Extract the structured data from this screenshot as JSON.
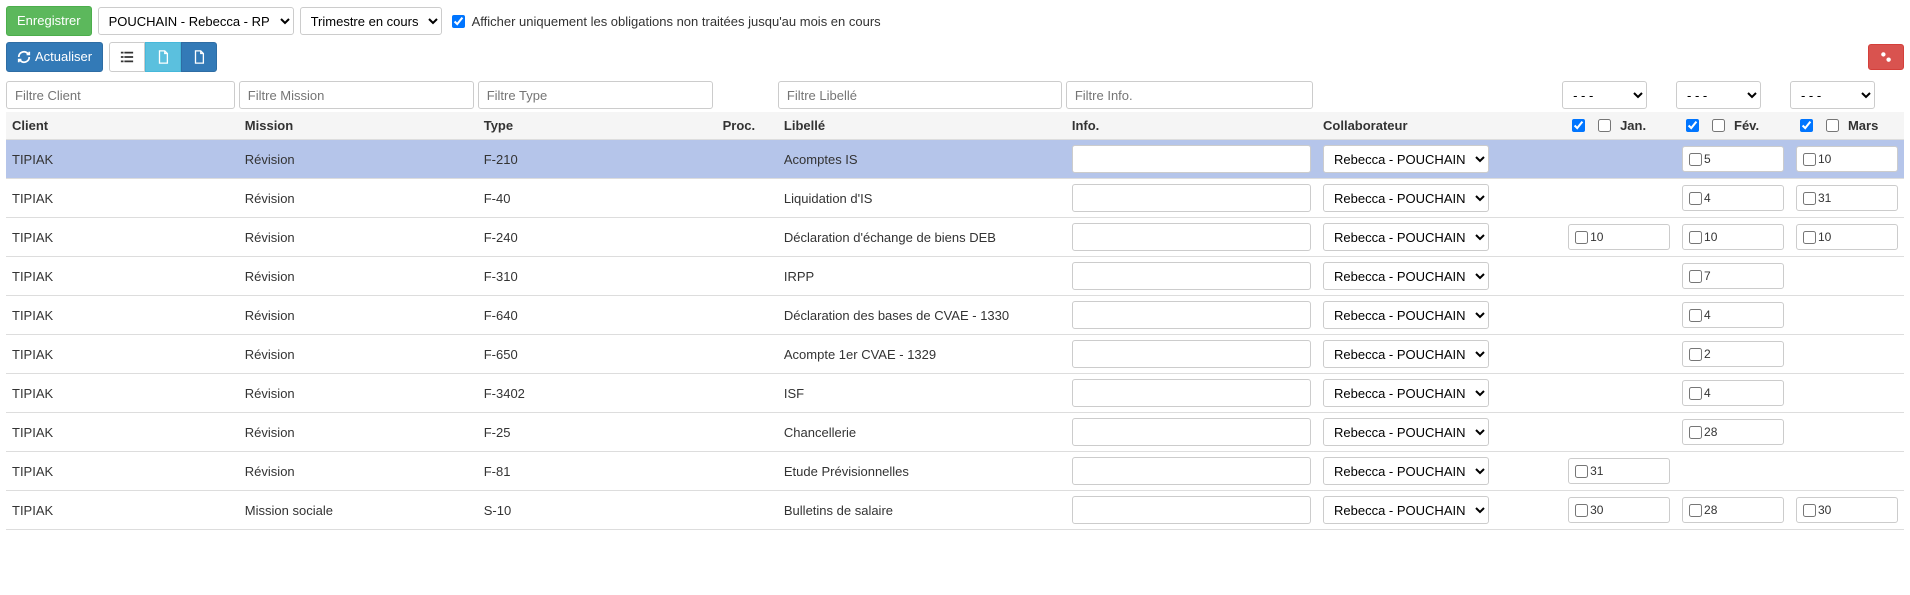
{
  "toolbar": {
    "save_label": "Enregistrer",
    "collab_selected": "POUCHAIN - Rebecca - RP",
    "period_selected": "Trimestre en cours",
    "checkbox_label": "Afficher uniquement les obligations non traitées jusqu'au mois en cours",
    "refresh_label": "Actualiser"
  },
  "filters": {
    "client_ph": "Filtre Client",
    "mission_ph": "Filtre Mission",
    "type_ph": "Filtre Type",
    "libelle_ph": "Filtre Libellé",
    "info_ph": "Filtre Info.",
    "month_default": "- - -"
  },
  "headers": {
    "client": "Client",
    "mission": "Mission",
    "type": "Type",
    "proc": "Proc.",
    "libelle": "Libellé",
    "info": "Info.",
    "collab": "Collaborateur",
    "jan": "Jan.",
    "fev": "Fév.",
    "mar": "Mars"
  },
  "collab_option": "Rebecca - POUCHAIN",
  "rows": [
    {
      "client": "TIPIAK",
      "mission": "Révision",
      "type": "F-210",
      "libelle": "Acomptes IS",
      "jan": "",
      "fev": "5",
      "mar": "10",
      "highlight": true
    },
    {
      "client": "TIPIAK",
      "mission": "Révision",
      "type": "F-40",
      "libelle": "Liquidation d'IS",
      "jan": "",
      "fev": "4",
      "mar": "31"
    },
    {
      "client": "TIPIAK",
      "mission": "Révision",
      "type": "F-240",
      "libelle": "Déclaration d'échange de biens DEB",
      "jan": "10",
      "fev": "10",
      "mar": "10"
    },
    {
      "client": "TIPIAK",
      "mission": "Révision",
      "type": "F-310",
      "libelle": "IRPP",
      "jan": "",
      "fev": "7",
      "mar": ""
    },
    {
      "client": "TIPIAK",
      "mission": "Révision",
      "type": "F-640",
      "libelle": "Déclaration des bases de CVAE - 1330",
      "jan": "",
      "fev": "4",
      "mar": ""
    },
    {
      "client": "TIPIAK",
      "mission": "Révision",
      "type": "F-650",
      "libelle": "Acompte 1er CVAE - 1329",
      "jan": "",
      "fev": "2",
      "mar": ""
    },
    {
      "client": "TIPIAK",
      "mission": "Révision",
      "type": "F-3402",
      "libelle": "ISF",
      "jan": "",
      "fev": "4",
      "mar": ""
    },
    {
      "client": "TIPIAK",
      "mission": "Révision",
      "type": "F-25",
      "libelle": "Chancellerie",
      "jan": "",
      "fev": "28",
      "mar": ""
    },
    {
      "client": "TIPIAK",
      "mission": "Révision",
      "type": "F-81",
      "libelle": "Etude Prévisionnelles",
      "jan": "31",
      "fev": "",
      "mar": ""
    },
    {
      "client": "TIPIAK",
      "mission": "Mission sociale",
      "type": "S-10",
      "libelle": "Bulletins de salaire",
      "jan": "30",
      "fev": "28",
      "mar": "30"
    }
  ]
}
